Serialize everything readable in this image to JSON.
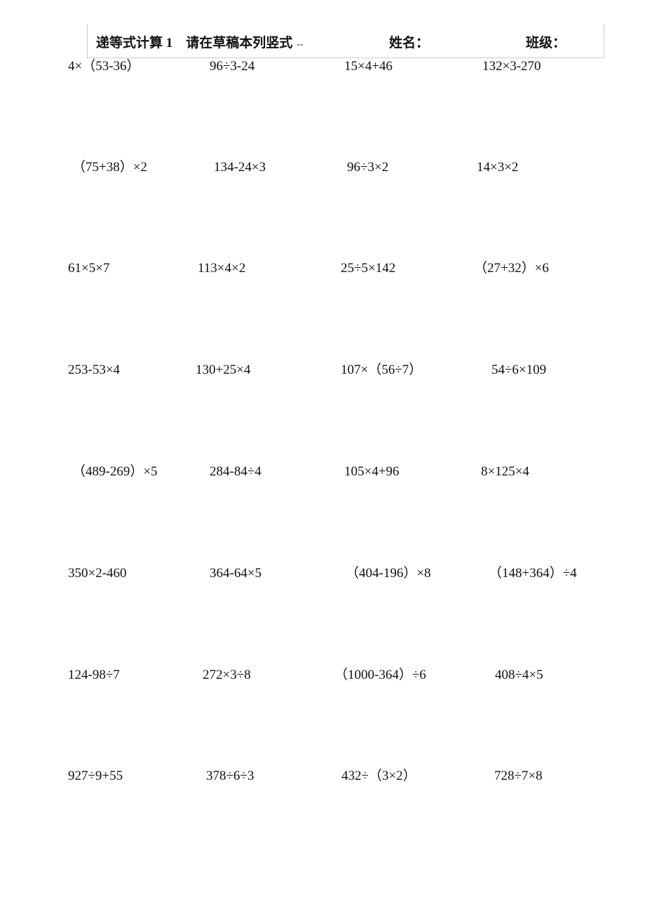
{
  "header": {
    "title": "递等式计算 1　请在草稿本列竖式",
    "title_dash": "--",
    "name_label": "姓名：",
    "class_label": "班级："
  },
  "problems": [
    [
      "4×（53-36）",
      "96÷3-24",
      "15×4+46",
      "132×3-270"
    ],
    [
      "（75+38）×2",
      "134-24×3",
      "96÷3×2",
      "14×3×2"
    ],
    [
      "61×5×7",
      "113×4×2",
      "25÷5×142",
      "（27+32）×6"
    ],
    [
      "253-53×4",
      "130+25×4",
      "107×（56÷7）",
      "54÷6×109"
    ],
    [
      "（489-269）×5",
      "284-84÷4",
      "105×4+96",
      "8×125×4"
    ],
    [
      "350×2-460",
      "364-64×5",
      "（404-196）×8",
      "（148+364）÷4"
    ],
    [
      "124-98÷7",
      "272×3÷8",
      "（1000-364）÷6",
      "408÷4×5"
    ],
    [
      "927÷9+55",
      "378÷6÷3",
      "432÷（3×2）",
      "728÷7×8"
    ]
  ]
}
